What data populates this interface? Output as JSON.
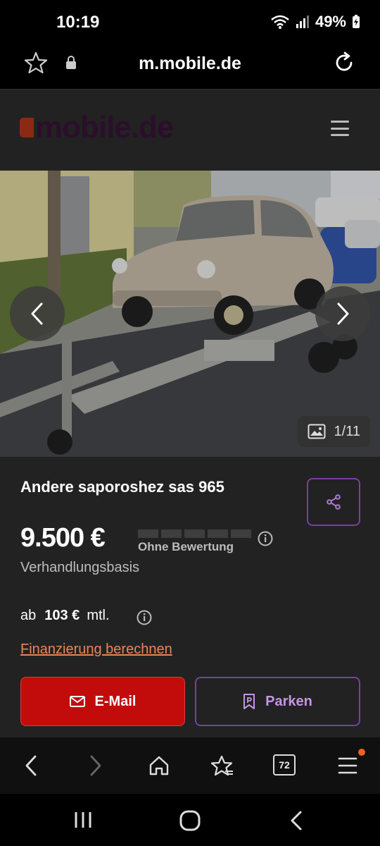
{
  "status_bar": {
    "time": "10:19",
    "battery": "49%"
  },
  "browser": {
    "url": "m.mobile.de",
    "tab_count": "72"
  },
  "site": {
    "logo_text": "mobile.de"
  },
  "gallery": {
    "counter": "1/11"
  },
  "listing": {
    "title": "Andere saporoshez sas 965",
    "price": "9.500 €",
    "rating_label": "Ohne Bewertung",
    "negotiable": "Verhandlungsbasis",
    "financing": {
      "prefix": "ab",
      "amount": "103 €",
      "suffix": "mtl."
    },
    "calculate_link": "Finanzierung berechnen",
    "email_button": "E-Mail",
    "park_button": "Parken"
  },
  "colors": {
    "accent_purple": "#7a3ea3",
    "email_red": "#c20c0c",
    "link_orange": "#e8865a"
  }
}
